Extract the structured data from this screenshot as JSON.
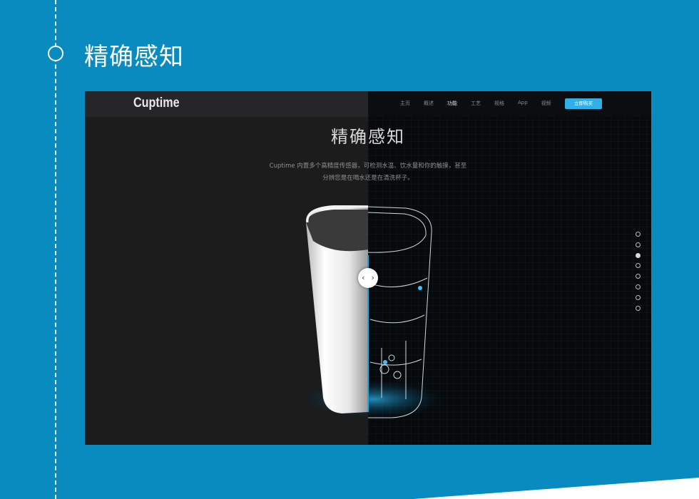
{
  "section": {
    "title": "精确感知"
  },
  "site": {
    "logo": "Cuptime",
    "nav": [
      "主页",
      "概述",
      "功能",
      "工艺",
      "规格",
      "App",
      "视频"
    ],
    "active_nav_index": 2,
    "buy_label": "立即购买",
    "accent_color": "#31b0e6"
  },
  "hero": {
    "title": "精确感知",
    "desc_line1": "Cuptime 内置多个高精度传感器，可检测水温、饮水量和你的触摸，甚至",
    "desc_line2": "分辨您是在喝水还是在清洗杯子。"
  },
  "pager": {
    "count": 8,
    "active_index": 2
  },
  "compare_handle": {
    "icon": "chevron-left-right-icon",
    "glyph": "‹ ›"
  },
  "colors": {
    "page_background": "#0a8bbf",
    "screenshot_left": "#1c1c1d",
    "screenshot_right": "#07090b"
  }
}
